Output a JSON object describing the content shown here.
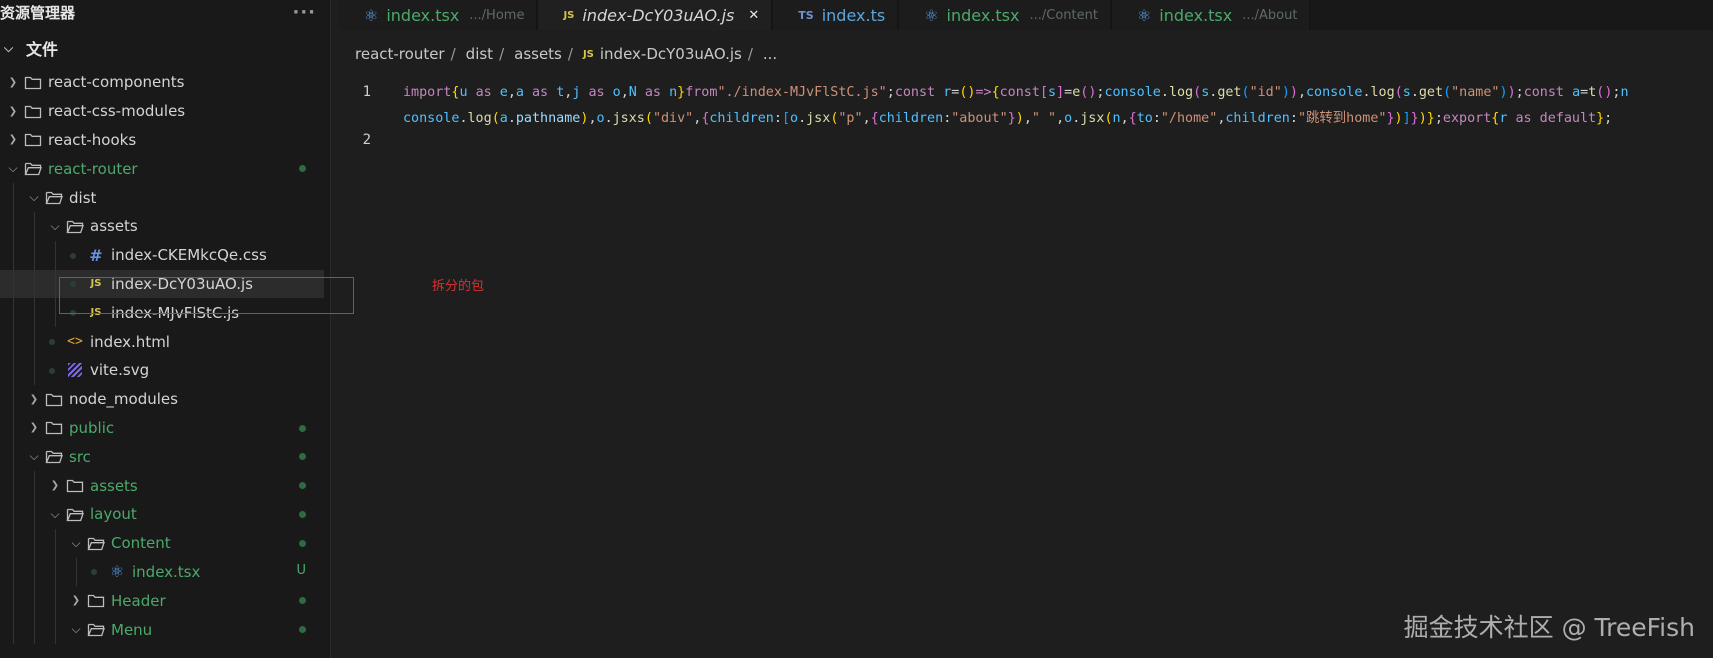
{
  "sidebar": {
    "title": "资源管理器",
    "more_label": "···",
    "section_label": "文件",
    "tree": [
      {
        "label": "react-components",
        "kind": "folder",
        "expanded": false,
        "green": false
      },
      {
        "label": "react-css-modules",
        "kind": "folder",
        "expanded": false,
        "green": false
      },
      {
        "label": "react-hooks",
        "kind": "folder",
        "expanded": false,
        "green": false
      },
      {
        "label": "react-router",
        "kind": "folder",
        "expanded": true,
        "green": true
      },
      {
        "label": "dist",
        "kind": "folder",
        "expanded": true,
        "green": false
      },
      {
        "label": "assets",
        "kind": "folder",
        "expanded": true,
        "green": false
      },
      {
        "label": "index-CKEMkcQe.css",
        "kind": "css-file",
        "green": false
      },
      {
        "label": "index-DcY03uAO.js",
        "kind": "js-file",
        "green": false,
        "selected": true
      },
      {
        "label": "index-MJvFlStC.js",
        "kind": "js-file",
        "green": false
      },
      {
        "label": "index.html",
        "kind": "html-file",
        "green": false
      },
      {
        "label": "vite.svg",
        "kind": "svg-file",
        "green": false
      },
      {
        "label": "node_modules",
        "kind": "folder",
        "expanded": false,
        "green": false
      },
      {
        "label": "public",
        "kind": "folder",
        "expanded": false,
        "green": true
      },
      {
        "label": "src",
        "kind": "folder",
        "expanded": true,
        "green": true
      },
      {
        "label": "assets",
        "kind": "folder",
        "expanded": false,
        "green": true
      },
      {
        "label": "layout",
        "kind": "folder",
        "expanded": true,
        "green": true
      },
      {
        "label": "Content",
        "kind": "folder",
        "expanded": true,
        "green": true
      },
      {
        "label": "index.tsx",
        "kind": "react-file",
        "green": true,
        "badge": "U"
      },
      {
        "label": "Header",
        "kind": "folder",
        "expanded": false,
        "green": true
      },
      {
        "label": "Menu",
        "kind": "folder",
        "expanded": true,
        "green": true
      }
    ]
  },
  "tabs": [
    {
      "name": "index.tsx",
      "desc": ".../Home",
      "icon": "react-icon"
    },
    {
      "name": "index-DcY03uAO.js",
      "desc": "",
      "icon": "js-icon",
      "active": true,
      "badge": "JS"
    },
    {
      "name": "index.ts",
      "desc": "",
      "icon": "ts-icon",
      "badge": "TS"
    },
    {
      "name": "index.tsx",
      "desc": ".../Content",
      "icon": "react-icon"
    },
    {
      "name": "index.tsx",
      "desc": ".../About",
      "icon": "react-icon"
    }
  ],
  "breadcrumb": {
    "items": [
      "react-router",
      "dist",
      "assets",
      "index-DcY03uAO.js",
      "..."
    ],
    "file_badge": "JS"
  },
  "editor": {
    "line_numbers": [
      "1",
      "2"
    ],
    "line1_part1": "import{u as e,a as t,j as o,N as n}from\"./index-MJvFlStC.js\";const r=()=>{const[s]=e();console.log(s.get(\"id\")),console.log(s.get(\"name\"));const a=t();n",
    "line1_part2": "console.log(a.pathname),o.jsxs(\"div\",{children:[o.jsx(\"p\",{children:\"about\"}),\" \",o.jsx(n,{to:\"/home\",children:\"跳转到home\"})]})};export{r as default};"
  },
  "annotation": "拆分的包",
  "watermark": "掘金技术社区 @ TreeFish",
  "colors": {
    "annotation": "#d9302f",
    "git_green": "#4ca96b",
    "background": "#1e1e1e"
  }
}
